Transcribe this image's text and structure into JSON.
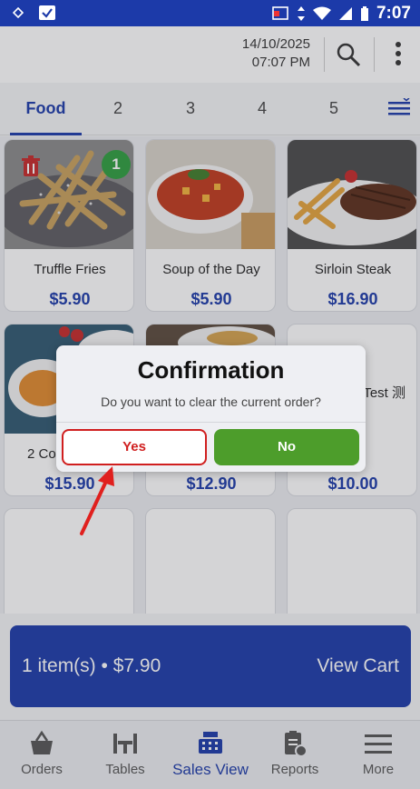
{
  "status_bar": {
    "time": "7:07"
  },
  "header": {
    "date": "14/10/2025",
    "time": "07:07 PM"
  },
  "tabs": [
    {
      "label": "Food",
      "active": true
    },
    {
      "label": "2",
      "active": false
    },
    {
      "label": "3",
      "active": false
    },
    {
      "label": "4",
      "active": false
    },
    {
      "label": "5",
      "active": false
    }
  ],
  "menu_items": [
    {
      "name": "Truffle Fries",
      "price": "$5.90",
      "qty_badge": "1"
    },
    {
      "name": "Soup of the Day",
      "price": "$5.90"
    },
    {
      "name": "Sirloin Steak",
      "price": "$16.90"
    },
    {
      "name": "2 Co",
      "price": "$15.90"
    },
    {
      "name": "",
      "price": "$12.90"
    },
    {
      "name": "Test 测",
      "price": "$10.00"
    }
  ],
  "dialog": {
    "title": "Confirmation",
    "message": "Do you want to clear the current order?",
    "yes_label": "Yes",
    "no_label": "No"
  },
  "cart": {
    "summary": "1 item(s) • $7.90",
    "view_label": "View Cart"
  },
  "bottom_nav": [
    {
      "label": "Orders",
      "icon": "basket-icon"
    },
    {
      "label": "Tables",
      "icon": "table-icon"
    },
    {
      "label": "Sales View",
      "icon": "register-icon",
      "active": true
    },
    {
      "label": "Reports",
      "icon": "report-icon"
    },
    {
      "label": "More",
      "icon": "hamburger-icon"
    }
  ],
  "colors": {
    "brand": "#1c3aa9",
    "yes": "#d01f1f",
    "no": "#4d9d2b",
    "badge": "#2e9e3e"
  }
}
